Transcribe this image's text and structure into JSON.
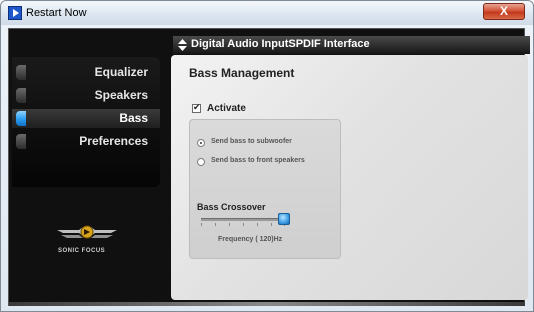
{
  "window": {
    "title": "Restart Now",
    "close_glyph": "X"
  },
  "nav": {
    "items": [
      {
        "label": "Equalizer",
        "active": false
      },
      {
        "label": "Speakers",
        "active": false
      },
      {
        "label": "Bass",
        "active": true
      },
      {
        "label": "Preferences",
        "active": false
      }
    ]
  },
  "logo": {
    "text": "SONIC FOCUS"
  },
  "header": {
    "text": "Digital Audio InputSPDIF Interface"
  },
  "panel": {
    "title": "Bass Management",
    "activate": {
      "label": "Activate",
      "checked": true
    },
    "options": [
      {
        "label": "Send bass to subwoofer",
        "selected": true
      },
      {
        "label": "Send bass to front speakers",
        "selected": false
      }
    ],
    "crossover": {
      "label": "Bass Crossover",
      "frequency_label": "Frequency  ( 120)Hz"
    }
  },
  "colors": {
    "accent": "#2a9cf0",
    "close": "#c3391d"
  }
}
